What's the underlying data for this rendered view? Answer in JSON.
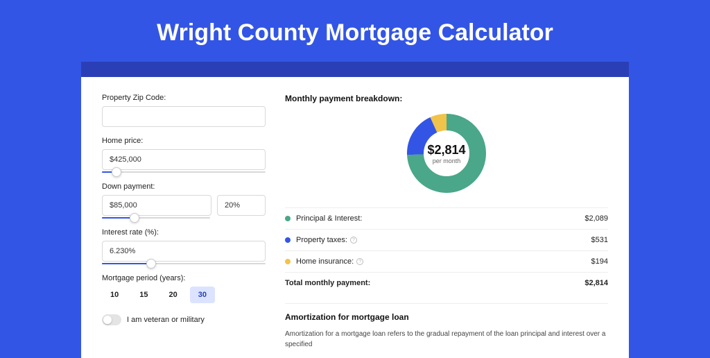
{
  "page_title": "Wright County Mortgage Calculator",
  "colors": {
    "principal": "#4aa789",
    "taxes": "#3355e6",
    "insurance": "#f0c34a"
  },
  "form": {
    "zip": {
      "label": "Property Zip Code:",
      "value": ""
    },
    "home_price": {
      "label": "Home price:",
      "value": "$425,000",
      "slider_pct": 9
    },
    "down_payment": {
      "label": "Down payment:",
      "value": "$85,000",
      "pct_value": "20%",
      "slider_pct": 20
    },
    "interest_rate": {
      "label": "Interest rate (%):",
      "value": "6.230%",
      "slider_pct": 30
    },
    "period": {
      "label": "Mortgage period (years):",
      "options": [
        "10",
        "15",
        "20",
        "30"
      ],
      "selected": "30"
    },
    "veteran": {
      "label": "I am veteran or military",
      "checked": false
    }
  },
  "breakdown": {
    "title": "Monthly payment breakdown:",
    "center_amount": "$2,814",
    "center_sub": "per month",
    "items": [
      {
        "label": "Principal & Interest:",
        "value": "$2,089",
        "help": false
      },
      {
        "label": "Property taxes:",
        "value": "$531",
        "help": true
      },
      {
        "label": "Home insurance:",
        "value": "$194",
        "help": true
      }
    ],
    "total": {
      "label": "Total monthly payment:",
      "value": "$2,814"
    }
  },
  "chart_data": {
    "type": "pie",
    "title": "Monthly payment breakdown",
    "categories": [
      "Principal & Interest",
      "Property taxes",
      "Home insurance"
    ],
    "values": [
      2089,
      531,
      194
    ],
    "total": 2814,
    "colors": [
      "#4aa789",
      "#3355e6",
      "#f0c34a"
    ]
  },
  "amortization": {
    "title": "Amortization for mortgage loan",
    "text": "Amortization for a mortgage loan refers to the gradual repayment of the loan principal and interest over a specified"
  }
}
